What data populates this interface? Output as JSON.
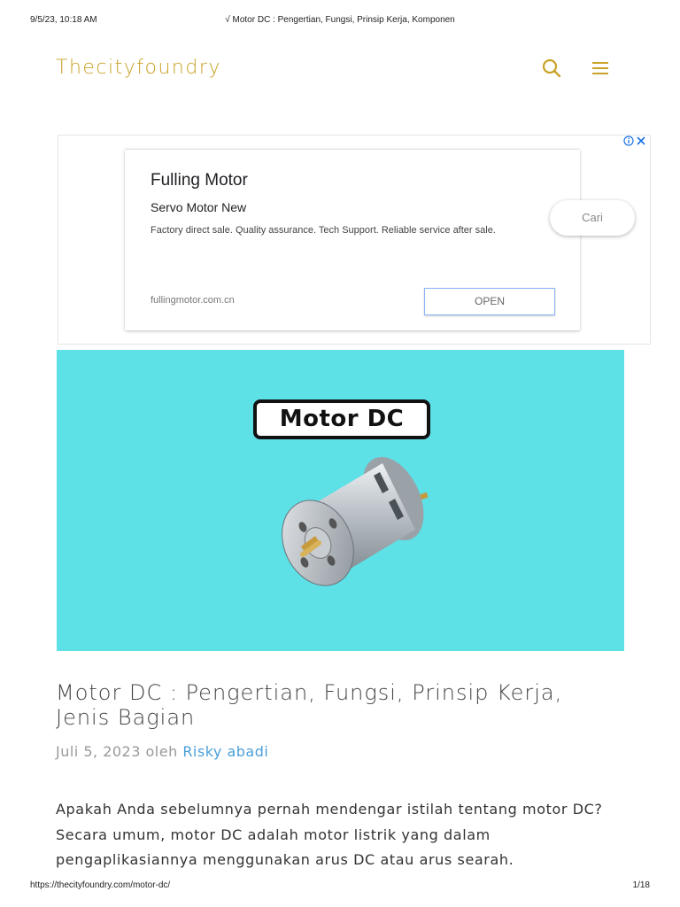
{
  "print": {
    "datetime": "9/5/23, 10:18 AM",
    "title": "√ Motor DC : Pengertian, Fungsi, Prinsip Kerja, Komponen",
    "url": "https://thecityfoundry.com/motor-dc/",
    "page": "1/18"
  },
  "header": {
    "logo": "Thecityfoundry",
    "accent": "#c9a227",
    "icons": [
      "search-icon",
      "menu-icon"
    ]
  },
  "ad": {
    "title": "Fulling Motor",
    "subtitle": "Servo Motor New",
    "description": "Factory direct sale. Quality assurance. Tech Support. Reliable service after sale.",
    "domain": "fullingmotor.com.cn",
    "open_label": "OPEN",
    "search_label": "Cari",
    "choices_icons": [
      "info-icon",
      "close-icon"
    ]
  },
  "hero": {
    "badge": "Motor DC",
    "background": "#5de0e6"
  },
  "article": {
    "title": "Motor DC : Pengertian, Fungsi, Prinsip Kerja, Jenis Bagian",
    "date": "Juli 5, 2023",
    "by": "oleh",
    "author": "Risky abadi",
    "intro": "Apakah Anda sebelumnya pernah mendengar istilah tentang motor DC? Secara umum, motor DC adalah motor listrik yang dalam pengaplikasiannya menggunakan arus DC atau arus searah."
  }
}
